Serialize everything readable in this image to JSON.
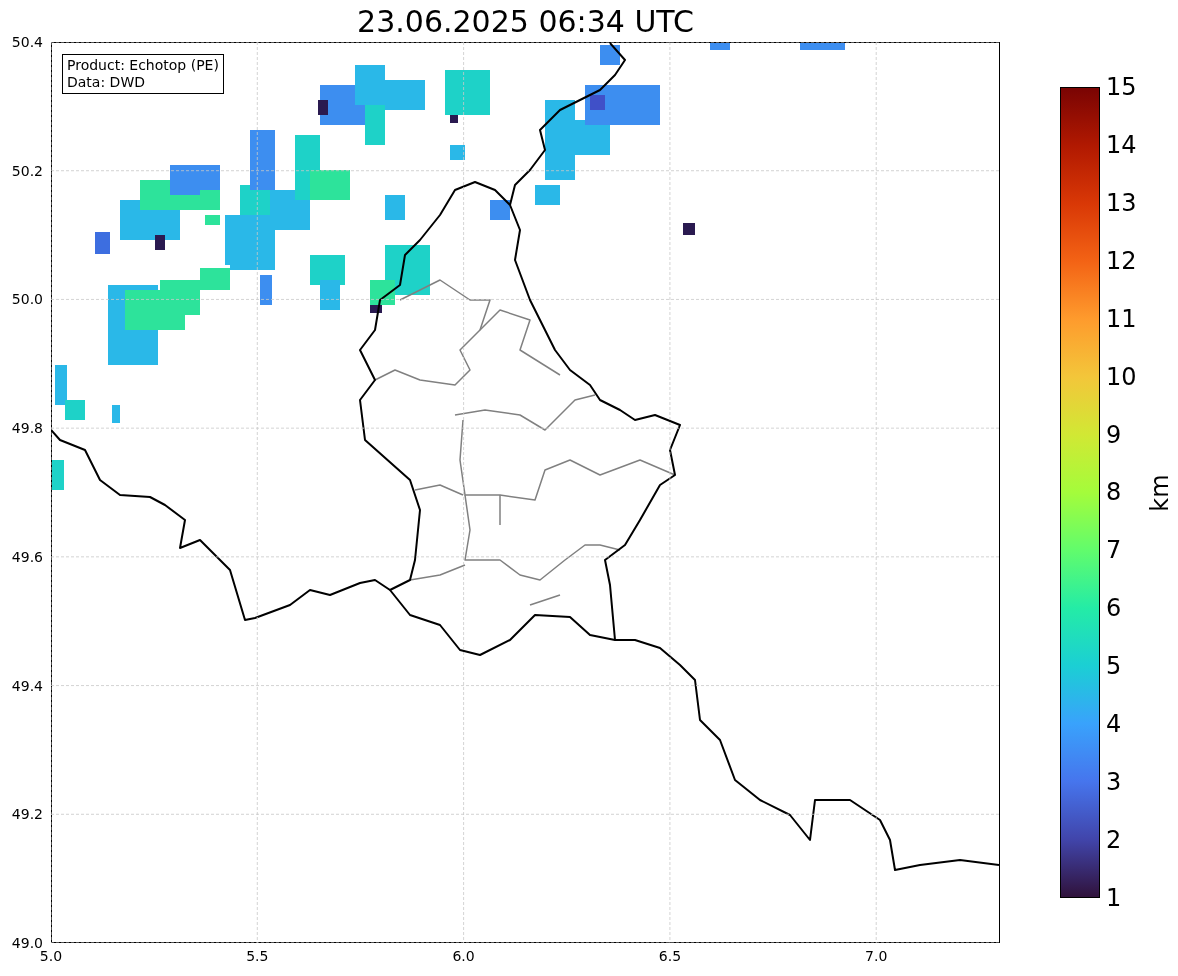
{
  "figure": {
    "info_box": {
      "lines": [
        "Product: Echotop (PE)",
        "Data: DWD"
      ]
    },
    "map": {
      "chart_data": {
        "type": "scatter",
        "title": "23.06.2025 06:34 UTC",
        "grid": true,
        "xlim": [
          5.0,
          7.3
        ],
        "ylim": [
          49.0,
          50.4
        ],
        "xticks": [
          {
            "value": 5.0,
            "label": "5.0"
          },
          {
            "value": 5.5,
            "label": "5.5"
          },
          {
            "value": 6.0,
            "label": "6.0"
          },
          {
            "value": 6.5,
            "label": "6.5"
          },
          {
            "value": 7.0,
            "label": "7.0"
          }
        ],
        "yticks": [
          {
            "value": 49.0,
            "label": "49.0"
          },
          {
            "value": 49.2,
            "label": "49.2"
          },
          {
            "value": 49.4,
            "label": "49.4"
          },
          {
            "value": 49.6,
            "label": "49.6"
          },
          {
            "value": 49.8,
            "label": "49.8"
          },
          {
            "value": 50.0,
            "label": "50.0"
          },
          {
            "value": 50.2,
            "label": "50.2"
          },
          {
            "value": 50.4,
            "label": "50.4"
          }
        ]
      }
    },
    "colorbar": {
      "label": "km",
      "ticks": [
        "15",
        "14",
        "13",
        "12",
        "11",
        "10",
        "9",
        "8",
        "7",
        "6",
        "5",
        "4",
        "3",
        "2",
        "1"
      ]
    }
  }
}
